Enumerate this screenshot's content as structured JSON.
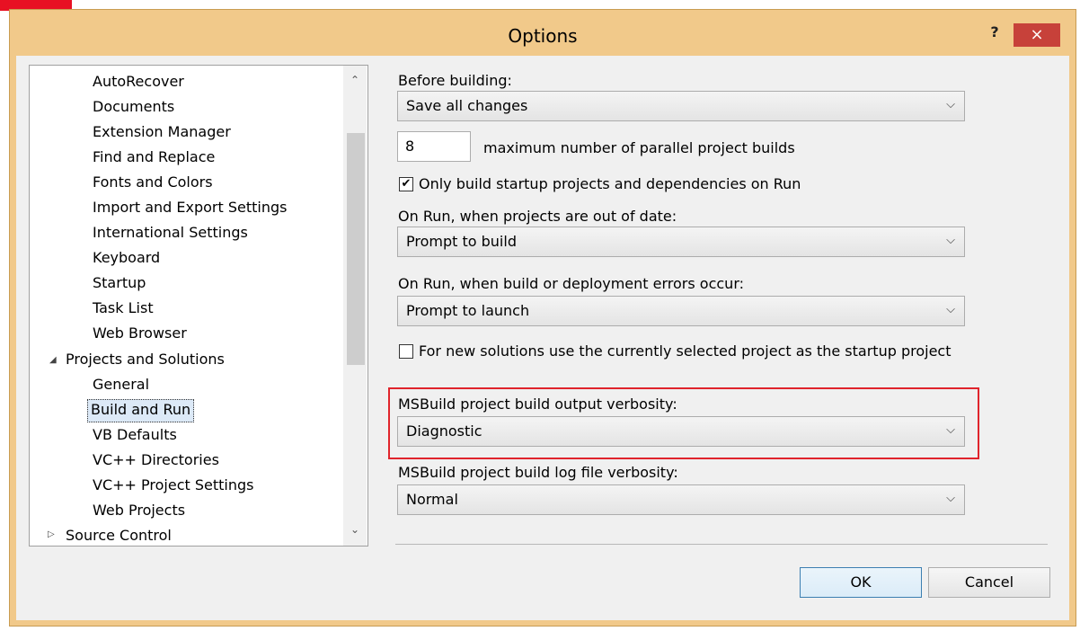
{
  "window": {
    "title": "Options",
    "help": "?",
    "close": "×"
  },
  "tree": {
    "items": [
      {
        "label": "AutoRecover"
      },
      {
        "label": "Documents"
      },
      {
        "label": "Extension Manager"
      },
      {
        "label": "Find and Replace"
      },
      {
        "label": "Fonts and Colors"
      },
      {
        "label": "Import and Export Settings"
      },
      {
        "label": "International Settings"
      },
      {
        "label": "Keyboard"
      },
      {
        "label": "Startup"
      },
      {
        "label": "Task List"
      },
      {
        "label": "Web Browser"
      },
      {
        "label": "Projects and Solutions"
      },
      {
        "label": "General"
      },
      {
        "label": "Build and Run"
      },
      {
        "label": "VB Defaults"
      },
      {
        "label": "VC++ Directories"
      },
      {
        "label": "VC++ Project Settings"
      },
      {
        "label": "Web Projects"
      },
      {
        "label": "Source Control"
      }
    ],
    "selected": "Build and Run"
  },
  "settings": {
    "before_building_label": "Before building:",
    "before_building_value": "Save all changes",
    "parallel_builds_value": "8",
    "parallel_builds_label": "maximum number of parallel project builds",
    "only_build_startup_label": "Only build startup projects and dependencies on Run",
    "only_build_startup_checked": true,
    "out_of_date_label": "On Run, when projects are out of date:",
    "out_of_date_value": "Prompt to build",
    "errors_label": "On Run, when build or deployment errors occur:",
    "errors_value": "Prompt to launch",
    "new_solutions_label": "For new solutions use the currently selected project as the startup project",
    "new_solutions_checked": false,
    "output_verbosity_label": "MSBuild project build output verbosity:",
    "output_verbosity_value": "Diagnostic",
    "log_verbosity_label": "MSBuild project build log file verbosity:",
    "log_verbosity_value": "Normal"
  },
  "buttons": {
    "ok": "OK",
    "cancel": "Cancel"
  },
  "icons": {
    "check": "✔",
    "chevron": "⌵",
    "scroll_up": "⌃",
    "scroll_down": "⌄",
    "expanded": "◢",
    "collapsed": "▷"
  },
  "colors": {
    "title_bar": "#f1c98a",
    "close_button": "#c7413a",
    "highlight_border": "#e0242c"
  }
}
